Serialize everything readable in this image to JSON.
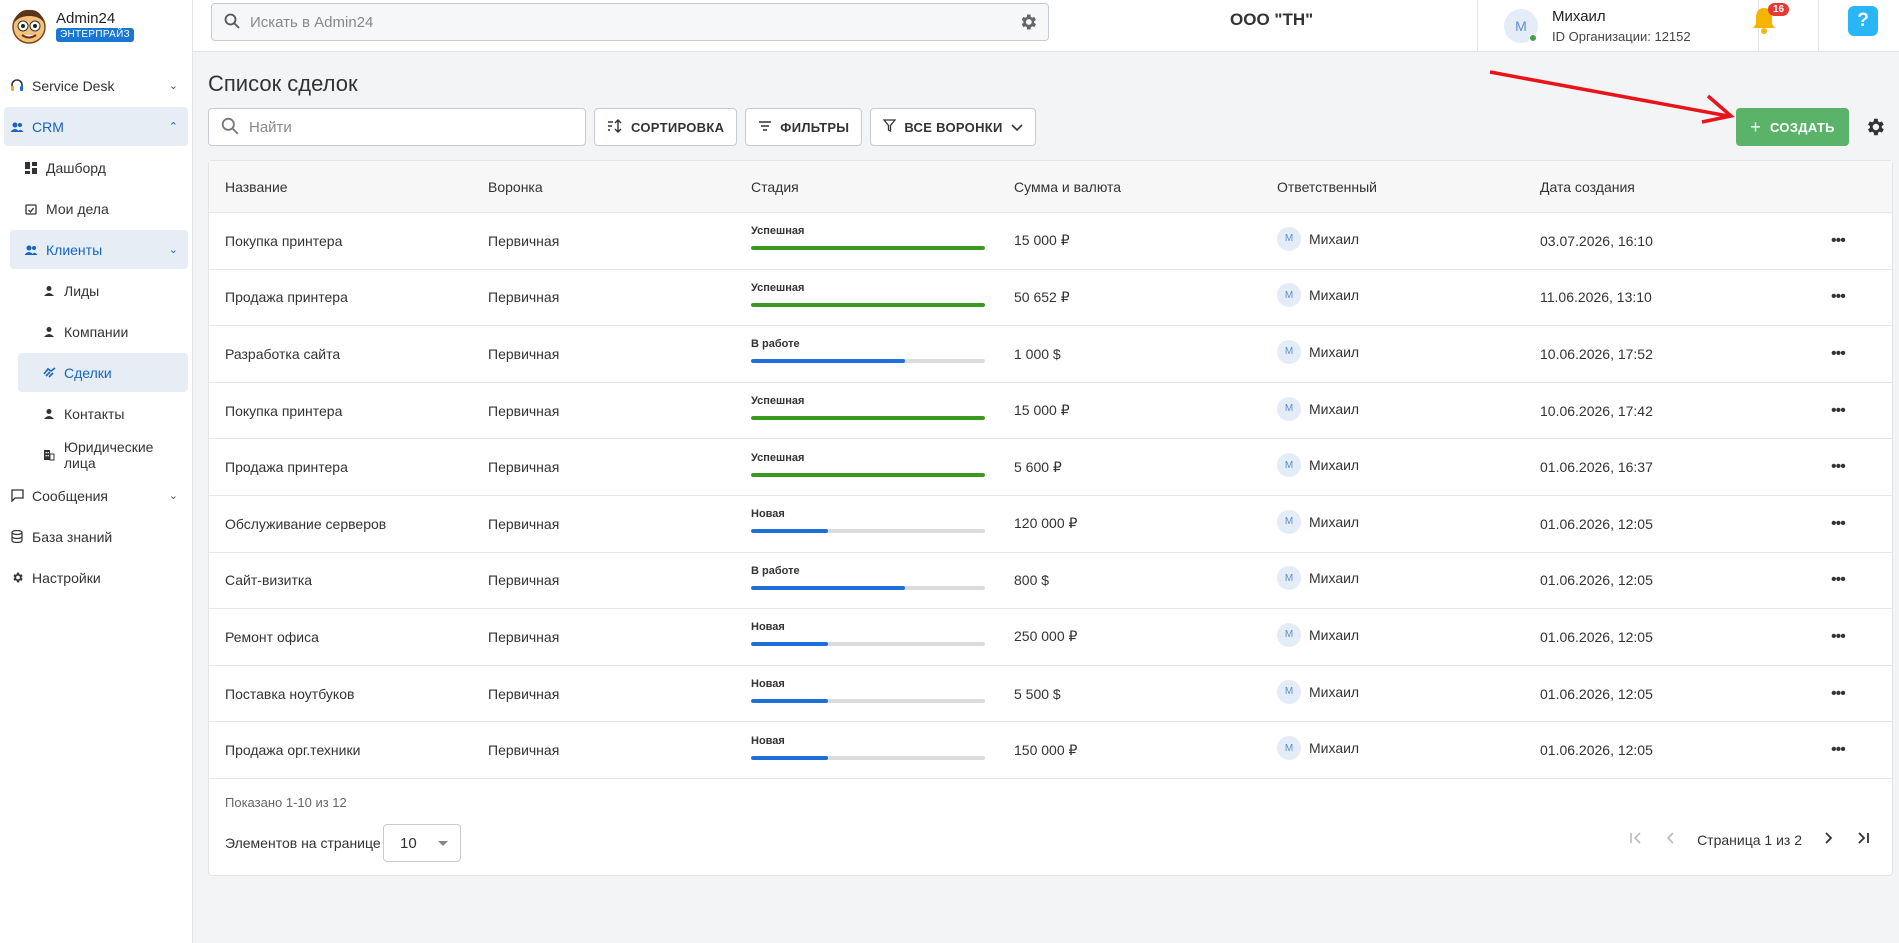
{
  "brand": {
    "name": "Admin24",
    "badge": "ЭНТЕРПРАЙЗ"
  },
  "header": {
    "search_placeholder": "Искать в Admin24",
    "org": "ООО \"ТН\"",
    "user": {
      "initial": "М",
      "name": "Михаил",
      "org_id": "ID Организации: 12152"
    },
    "notifications": "16",
    "help": "?"
  },
  "sidebar": {
    "items": [
      {
        "label": "Service Desk",
        "icon": "headset-icon"
      },
      {
        "label": "CRM",
        "icon": "people-icon"
      },
      {
        "label": "Дашборд",
        "icon": "dashboard-icon"
      },
      {
        "label": "Мои дела",
        "icon": "calendar-check-icon"
      },
      {
        "label": "Клиенты",
        "icon": "people-icon"
      },
      {
        "label": "Лиды",
        "icon": "person-icon"
      },
      {
        "label": "Компании",
        "icon": "person-icon"
      },
      {
        "label": "Сделки",
        "icon": "handshake-icon"
      },
      {
        "label": "Контакты",
        "icon": "person-icon"
      },
      {
        "label": "Юридические лица",
        "icon": "building-icon"
      },
      {
        "label": "Сообщения",
        "icon": "chat-icon"
      },
      {
        "label": "База знаний",
        "icon": "database-icon"
      },
      {
        "label": "Настройки",
        "icon": "gear-icon"
      }
    ]
  },
  "main": {
    "title": "Список сделок",
    "search_placeholder": "Найти",
    "sort_label": "СОРТИРОВКА",
    "filters_label": "ФИЛЬТРЫ",
    "funnels_label": "ВСЕ ВОРОНКИ",
    "create_label": "СОЗДАТЬ"
  },
  "table": {
    "columns": [
      "Название",
      "Воронка",
      "Стадия",
      "Сумма и валюта",
      "Ответственный",
      "Дата создания"
    ],
    "rows": [
      {
        "name": "Покупка принтера",
        "funnel": "Первичная",
        "stage": "Успешная",
        "progress": 1.0,
        "color": "#3a9a1f",
        "amount": "15 000 ₽",
        "resp_initial": "М",
        "resp": "Михаил",
        "date": "03.07.2026, 16:10"
      },
      {
        "name": "Продажа принтера",
        "funnel": "Первичная",
        "stage": "Успешная",
        "progress": 1.0,
        "color": "#3a9a1f",
        "amount": "50 652 ₽",
        "resp_initial": "М",
        "resp": "Михаил",
        "date": "11.06.2026, 13:10"
      },
      {
        "name": "Разработка сайта",
        "funnel": "Первичная",
        "stage": "В работе",
        "progress": 0.66,
        "color": "#1e6fd9",
        "amount": "1 000 $",
        "resp_initial": "М",
        "resp": "Михаил",
        "date": "10.06.2026, 17:52"
      },
      {
        "name": "Покупка принтера",
        "funnel": "Первичная",
        "stage": "Успешная",
        "progress": 1.0,
        "color": "#3a9a1f",
        "amount": "15 000 ₽",
        "resp_initial": "М",
        "resp": "Михаил",
        "date": "10.06.2026, 17:42"
      },
      {
        "name": "Продажа принтера",
        "funnel": "Первичная",
        "stage": "Успешная",
        "progress": 1.0,
        "color": "#3a9a1f",
        "amount": "5 600 ₽",
        "resp_initial": "М",
        "resp": "Михаил",
        "date": "01.06.2026, 16:37"
      },
      {
        "name": "Обслуживание серверов",
        "funnel": "Первичная",
        "stage": "Новая",
        "progress": 0.33,
        "color": "#1e6fd9",
        "amount": "120 000 ₽",
        "resp_initial": "М",
        "resp": "Михаил",
        "date": "01.06.2026, 12:05"
      },
      {
        "name": "Сайт-визитка",
        "funnel": "Первичная",
        "stage": "В работе",
        "progress": 0.66,
        "color": "#1e6fd9",
        "amount": "800 $",
        "resp_initial": "М",
        "resp": "Михаил",
        "date": "01.06.2026, 12:05"
      },
      {
        "name": "Ремонт офиса",
        "funnel": "Первичная",
        "stage": "Новая",
        "progress": 0.33,
        "color": "#1e6fd9",
        "amount": "250 000 ₽",
        "resp_initial": "М",
        "resp": "Михаил",
        "date": "01.06.2026, 12:05"
      },
      {
        "name": "Поставка ноутбуков",
        "funnel": "Первичная",
        "stage": "Новая",
        "progress": 0.33,
        "color": "#1e6fd9",
        "amount": "5 500 $",
        "resp_initial": "М",
        "resp": "Михаил",
        "date": "01.06.2026, 12:05"
      },
      {
        "name": "Продажа орг.техники",
        "funnel": "Первичная",
        "stage": "Новая",
        "progress": 0.33,
        "color": "#1e6fd9",
        "amount": "150 000 ₽",
        "resp_initial": "М",
        "resp": "Михаил",
        "date": "01.06.2026, 12:05"
      }
    ],
    "shown": "Показано 1-10 из 12",
    "per_page_label": "Элементов на странице",
    "per_page_value": "10",
    "page_text": "Страница 1 из 2"
  },
  "colors": {
    "accent": "#1565c0",
    "create": "#5bb36a",
    "success": "#3a9a1f",
    "progress": "#1e6fd9",
    "arrow": "#e8141a"
  }
}
